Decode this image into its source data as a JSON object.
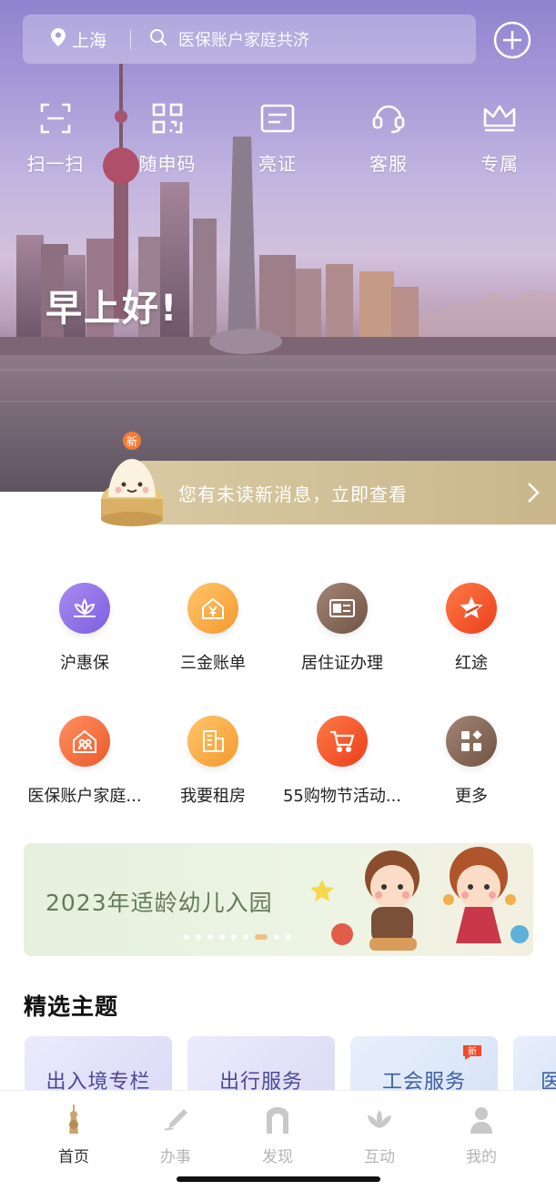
{
  "header": {
    "location": "上海",
    "search_placeholder": "医保账户家庭共济"
  },
  "quick_actions": [
    {
      "label": "扫一扫",
      "icon": "scan-icon"
    },
    {
      "label": "随申码",
      "icon": "qr-code-icon"
    },
    {
      "label": "亮证",
      "icon": "card-icon"
    },
    {
      "label": "客服",
      "icon": "headset-icon"
    },
    {
      "label": "专属",
      "icon": "crown-icon"
    }
  ],
  "greeting": "早上好!",
  "notice": {
    "badge": "新",
    "text": "您有未读新消息，立即查看"
  },
  "services": [
    {
      "label": "沪惠保",
      "icon": "lotus-icon",
      "color": "#8e72e6"
    },
    {
      "label": "三金账单",
      "icon": "yen-house-icon",
      "color": "#f6a94a"
    },
    {
      "label": "居住证办理",
      "icon": "id-card-icon",
      "color": "#8a6d5c"
    },
    {
      "label": "红途",
      "icon": "star-icon",
      "color": "#f0532c"
    },
    {
      "label": "医保账户家庭...",
      "icon": "family-house-icon",
      "color": "#f37a45"
    },
    {
      "label": "我要租房",
      "icon": "building-icon",
      "color": "#f4a444"
    },
    {
      "label": "55购物节活动...",
      "icon": "cart-icon",
      "color": "#f25a32"
    },
    {
      "label": "更多",
      "icon": "grid-icon",
      "color": "#8a6d5c"
    }
  ],
  "banner": {
    "title": "2023年适龄幼儿入园",
    "dots_count": 9,
    "active_dot": 6
  },
  "themes_section": {
    "title": "精选主题",
    "items": [
      {
        "label": "出入境专栏"
      },
      {
        "label": "出行服务"
      },
      {
        "label": "工会服务",
        "badge": "新"
      },
      {
        "label": "医"
      }
    ]
  },
  "tabbar": [
    {
      "label": "首页",
      "icon": "home-tower-icon",
      "active": true
    },
    {
      "label": "办事",
      "icon": "pen-icon",
      "active": false
    },
    {
      "label": "发现",
      "icon": "gate-icon",
      "active": false
    },
    {
      "label": "互动",
      "icon": "flower-icon",
      "active": false
    },
    {
      "label": "我的",
      "icon": "person-icon",
      "active": false
    }
  ]
}
